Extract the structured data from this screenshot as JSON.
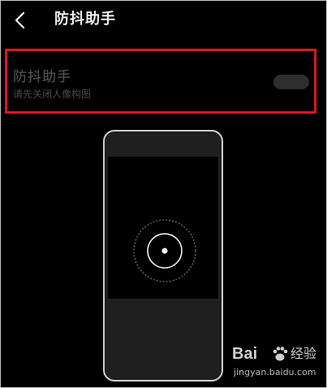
{
  "header": {
    "title": "防抖助手",
    "back_icon": "chevron-left-icon"
  },
  "setting": {
    "title": "防抖助手",
    "subtitle": "请先关闭人像构图",
    "toggle_state": "off",
    "highlight_color": "#d9171e"
  },
  "watermark": {
    "brand_left": "Bai",
    "brand_right": "经验",
    "url": "jingyan.baidu.com"
  }
}
